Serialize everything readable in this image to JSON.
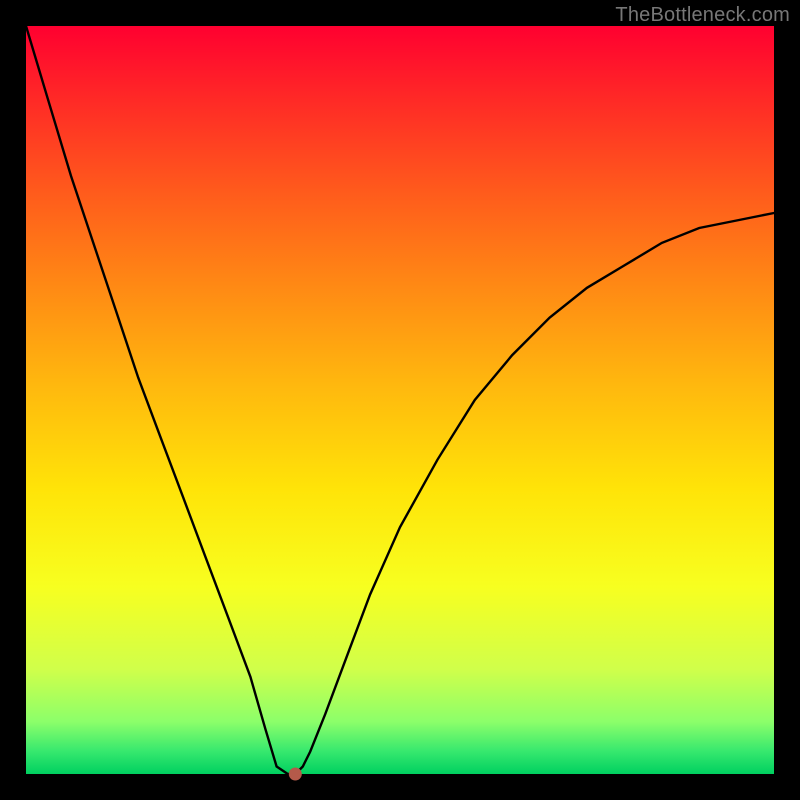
{
  "watermark": "TheBottleneck.com",
  "chart_data": {
    "type": "line",
    "title": "",
    "xlabel": "",
    "ylabel": "",
    "xlim": [
      0,
      100
    ],
    "ylim": [
      0,
      100
    ],
    "series": [
      {
        "name": "curve",
        "x": [
          0,
          3,
          6,
          9,
          12,
          15,
          18,
          21,
          24,
          27,
          30,
          32,
          33.5,
          35,
          36,
          37,
          38,
          40,
          43,
          46,
          50,
          55,
          60,
          65,
          70,
          75,
          80,
          85,
          90,
          95,
          100
        ],
        "y": [
          100,
          90,
          80,
          71,
          62,
          53,
          45,
          37,
          29,
          21,
          13,
          6,
          1,
          0,
          0,
          1,
          3,
          8,
          16,
          24,
          33,
          42,
          50,
          56,
          61,
          65,
          68,
          71,
          73,
          74,
          75
        ]
      }
    ],
    "marker": {
      "x": 36,
      "y": 0,
      "color": "#b45a4a"
    },
    "background_gradient": {
      "type": "vertical",
      "stops": [
        {
          "pos": 0,
          "color": "#ff0030"
        },
        {
          "pos": 50,
          "color": "#ffcc00"
        },
        {
          "pos": 100,
          "color": "#00d060"
        }
      ]
    }
  }
}
